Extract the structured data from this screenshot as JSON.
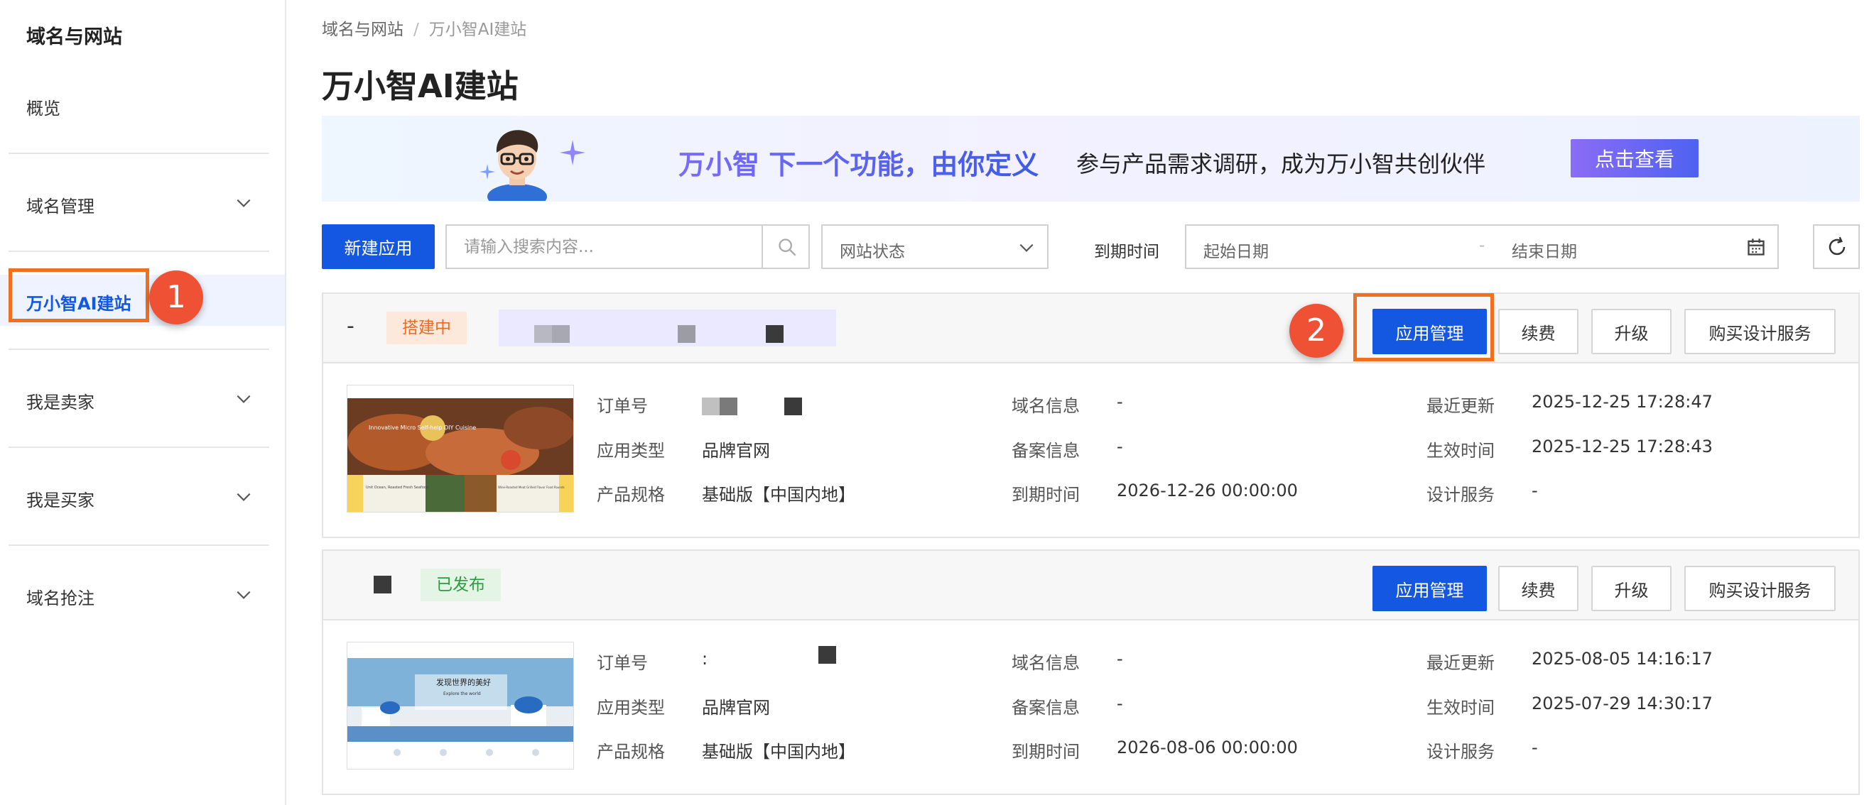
{
  "sidebar": {
    "title": "域名与网站",
    "items": [
      {
        "label": "概览"
      },
      {
        "label": "域名管理"
      },
      {
        "label": "万小智AI建站"
      },
      {
        "label": "我是卖家"
      },
      {
        "label": "我是买家"
      },
      {
        "label": "域名抢注"
      }
    ]
  },
  "annotations": {
    "step1": "1",
    "step2": "2"
  },
  "breadcrumb": {
    "root": "域名与网站",
    "sep": "/",
    "current": "万小智AI建站"
  },
  "page": {
    "title": "万小智AI建站"
  },
  "banner": {
    "headline": "万小智 下一个功能，由你定义",
    "subtitle": "参与产品需求调研，成为万小智共创伙伴",
    "button": "点击查看"
  },
  "toolbar": {
    "new_app": "新建应用",
    "search_placeholder": "请输入搜索内容...",
    "status_select": "网站状态",
    "expiry_label": "到期时间",
    "date_start": "起始日期",
    "date_sep": "-",
    "date_end": "结束日期"
  },
  "labels": {
    "order_no": "订单号",
    "app_type": "应用类型",
    "product_spec": "产品规格",
    "domain_info": "域名信息",
    "filing_info": "备案信息",
    "expiry": "到期时间",
    "last_update": "最近更新",
    "effective_time": "生效时间",
    "design_service": "设计服务"
  },
  "card_buttons": {
    "manage": "应用管理",
    "renew": "续费",
    "upgrade": "升级",
    "buy_design": "购买设计服务"
  },
  "apps": [
    {
      "name": "-",
      "status": "搭建中",
      "order_no": "",
      "app_type": "品牌官网",
      "product_spec": "基础版【中国内地】",
      "domain_info": "-",
      "filing_info": "-",
      "expiry": "2026-12-26 00:00:00",
      "last_update": "2025-12-25 17:28:47",
      "effective_time": "2025-12-25 17:28:43",
      "design_service": "-",
      "thumb_text": "Innovative Micro Self-help DIY Cuisine",
      "thumb_cap1": "Unit Ocean, Roasted Fresh Seafood",
      "thumb_cap2": "Wine-Roasted Meat Grilled Flavor Food Rounds"
    },
    {
      "name": "",
      "status": "已发布",
      "order_no": ":",
      "app_type": "品牌官网",
      "product_spec": "基础版【中国内地】",
      "domain_info": "-",
      "filing_info": "-",
      "expiry": "2026-08-06 00:00:00",
      "last_update": "2025-08-05 14:16:17",
      "effective_time": "2025-07-29 14:30:17",
      "design_service": "-",
      "thumb_text": "发现世界的美好",
      "thumb_sub": "Explore the world"
    }
  ],
  "colors": {
    "primary": "#1457e0",
    "annotation": "#f07020",
    "badge": "#ef5134",
    "building": "#ee6a1f",
    "published": "#2e9a44"
  },
  "icons": [
    "chevron-down-icon",
    "search-icon",
    "calendar-icon",
    "refresh-icon",
    "sparkle-icon"
  ]
}
